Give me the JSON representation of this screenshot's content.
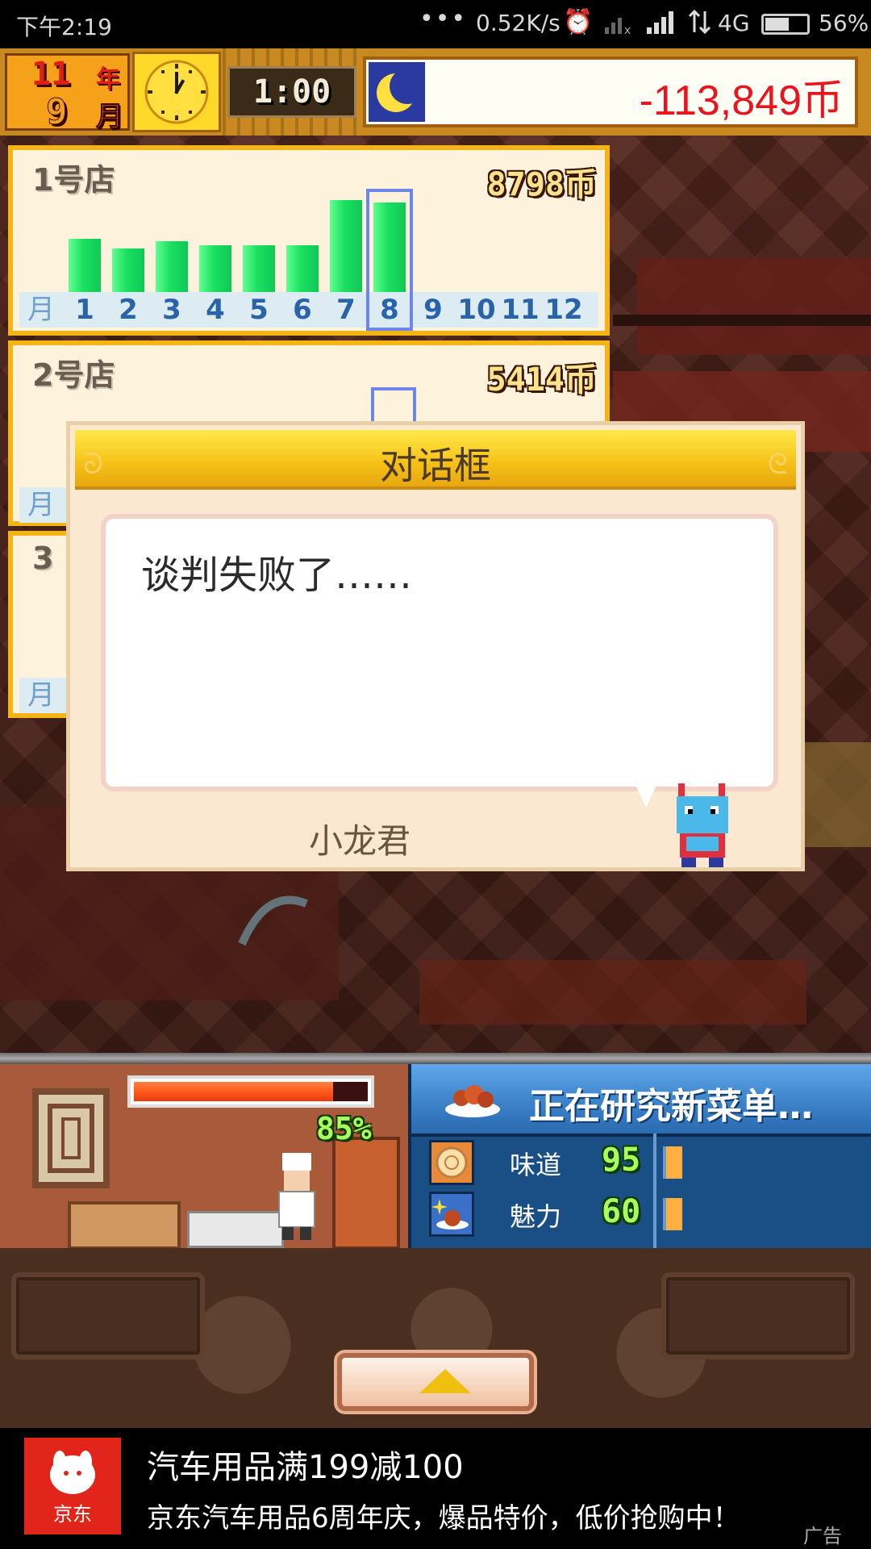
{
  "status_bar": {
    "time": "下午2:19",
    "dots": "•••",
    "speed": "0.52K/s",
    "network": "4G",
    "battery_level": 56,
    "battery_pct": "56%"
  },
  "hud": {
    "year_num": "11",
    "year_unit": "年",
    "month_num": "9",
    "month_unit": "月",
    "time": "1:00",
    "money": "-113,849币"
  },
  "stores": [
    {
      "name": "1号店",
      "amount": "8798币",
      "axis_unit": "月",
      "months": [
        "1",
        "2",
        "3",
        "4",
        "5",
        "6",
        "7",
        "8",
        "9",
        "10",
        "11",
        "12"
      ],
      "selected_month": 8,
      "bars": [
        0.58,
        0.47,
        0.55,
        0.51,
        0.51,
        0.51,
        1.0,
        0.97
      ]
    },
    {
      "name": "2号店",
      "amount": "5414币",
      "axis_unit": "月"
    },
    {
      "name": "3",
      "axis_unit": "月"
    }
  ],
  "dialog": {
    "title": "对话框",
    "message": "谈判失败了……",
    "speaker": "小龙君"
  },
  "kitchen": {
    "progress": 0.85,
    "progress_label": "85%"
  },
  "research": {
    "title": "正在研究新菜单…",
    "stats": [
      {
        "label": "味道",
        "value": "95"
      },
      {
        "label": "魅力",
        "value": "60"
      }
    ]
  },
  "ad": {
    "brand": "京东",
    "headline": "汽车用品满199减100",
    "description": "京东汽车用品6周年庆，爆品特价，低价抢购中！",
    "tag": "广告"
  },
  "colors": {
    "money_red": "#e8151f",
    "bar_green": "#1ae060",
    "panel_gold": "#f5b416",
    "research_blue": "#1a4f86"
  }
}
